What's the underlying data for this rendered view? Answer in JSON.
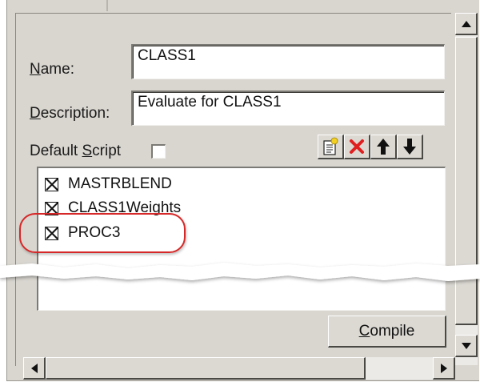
{
  "form": {
    "name_label_key": "N",
    "name_label_rest": "ame:",
    "name_value": "CLASS1",
    "description_label_key": "D",
    "description_label_rest": "escription:",
    "description_value": "Evaluate for CLASS1",
    "default_script_label_pre": "Default ",
    "default_script_label_key": "S",
    "default_script_label_rest": "cript",
    "default_script_checked": false
  },
  "toolbar": {
    "buttons": [
      {
        "icon": "new-script-icon"
      },
      {
        "icon": "delete-icon",
        "color": "#e02020"
      },
      {
        "icon": "move-up-icon"
      },
      {
        "icon": "move-down-icon"
      }
    ]
  },
  "scripts": [
    {
      "label": "MASTRBLEND",
      "checked": true
    },
    {
      "label": "CLASS1Weights",
      "checked": true
    },
    {
      "label": "PROC3",
      "checked": true,
      "highlighted": true
    }
  ],
  "compile_button": {
    "key": "C",
    "rest": "ompile"
  },
  "colors": {
    "highlight": "#d62828",
    "panel": "#d9d6d0"
  }
}
